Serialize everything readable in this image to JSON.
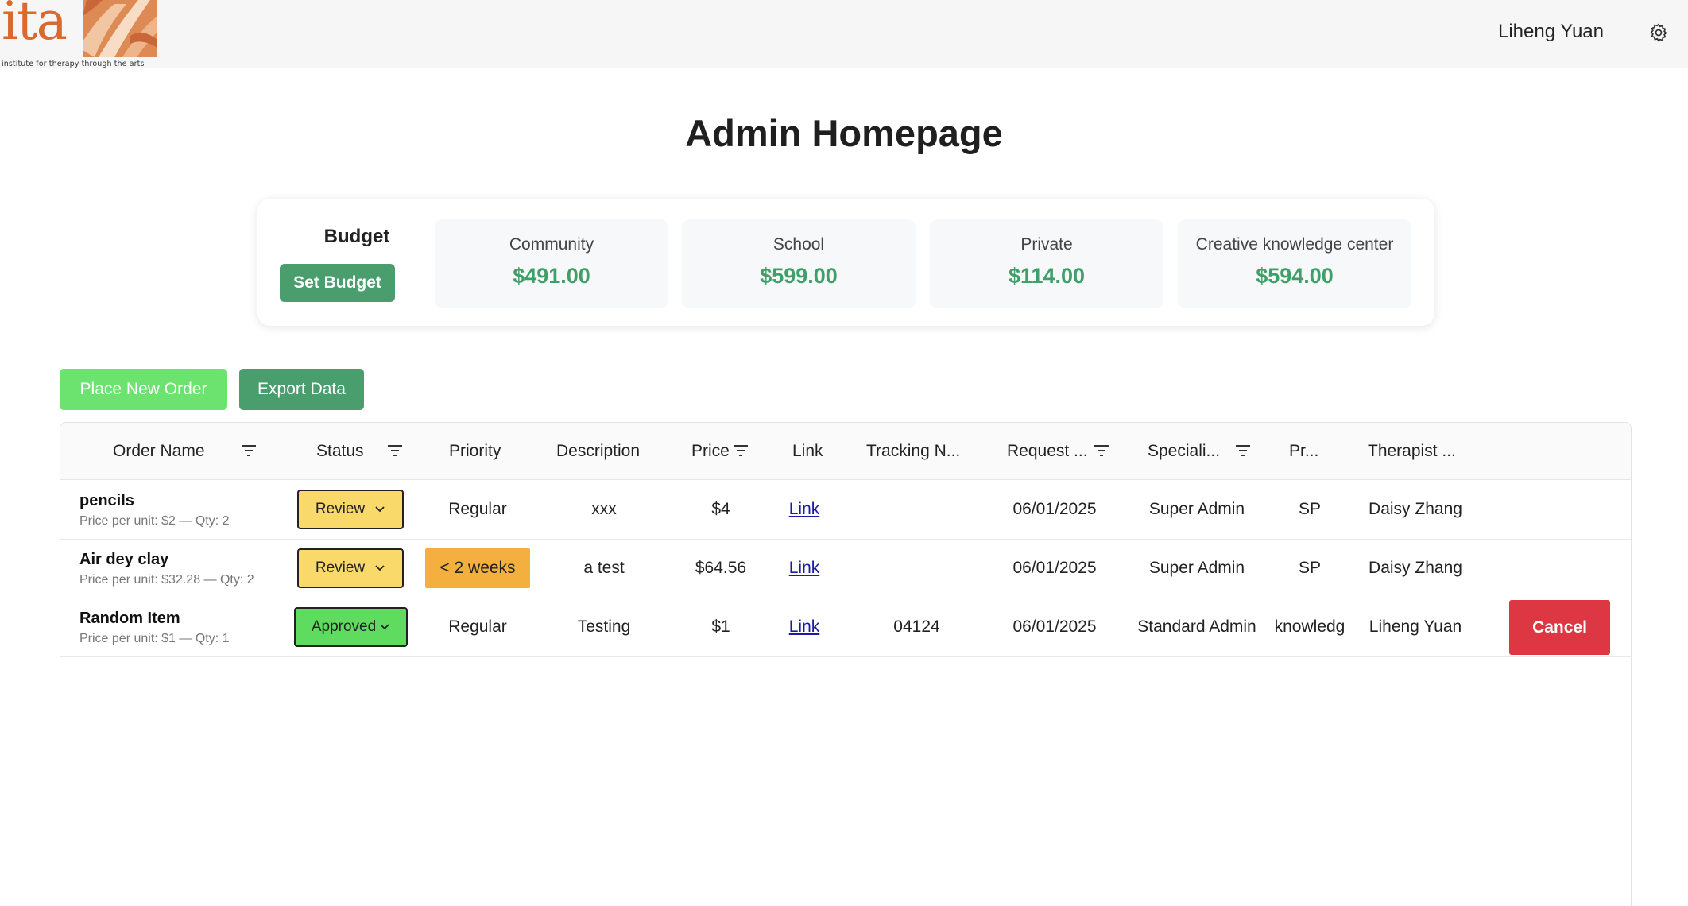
{
  "header": {
    "logo_text": "ita",
    "logo_tagline": "institute for therapy through the arts",
    "user_name": "Liheng Yuan",
    "settings_icon": "gear-icon"
  },
  "page": {
    "title": "Admin Homepage"
  },
  "budget": {
    "label": "Budget",
    "set_budget_label": "Set Budget",
    "tiles": [
      {
        "name": "Community",
        "amount": "$491.00"
      },
      {
        "name": "School",
        "amount": "$599.00"
      },
      {
        "name": "Private",
        "amount": "$114.00"
      },
      {
        "name": "Creative knowledge center",
        "amount": "$594.00"
      }
    ],
    "amount_color": "#3f9f68"
  },
  "actions": {
    "place_order_label": "Place New Order",
    "export_label": "Export Data"
  },
  "table": {
    "columns": [
      "Order Name",
      "Status",
      "Priority",
      "Description",
      "Price",
      "Link",
      "Tracking N...",
      "Request ...",
      "Speciali...",
      "Pr...",
      "Therapist ..."
    ],
    "rows": [
      {
        "name": "pencils",
        "details": "Price per unit: $2 — Qty: 2",
        "status": "Review",
        "priority": "Regular",
        "description": "xxx",
        "price": "$4",
        "link": "Link",
        "tracking": "",
        "request_date": "06/01/2025",
        "specialist": "Super Admin",
        "program": "SP",
        "therapist": "Daisy Zhang"
      },
      {
        "name": "Air dey clay",
        "details": "Price per unit: $32.28 — Qty: 2",
        "status": "Review",
        "priority": "< 2 weeks",
        "description": "a test",
        "price": "$64.56",
        "link": "Link",
        "tracking": "",
        "request_date": "06/01/2025",
        "specialist": "Super Admin",
        "program": "SP",
        "therapist": "Daisy Zhang"
      },
      {
        "name": "Random Item",
        "details": "Price per unit: $1 — Qty: 1",
        "status": "Approved",
        "priority": "Regular",
        "description": "Testing",
        "price": "$1",
        "link": "Link",
        "tracking": "04124",
        "request_date": "06/01/2025",
        "specialist": "Standard Admin",
        "program": "knowledg",
        "therapist": "Liheng Yuan",
        "action": "Cancel"
      }
    ]
  },
  "colors": {
    "primary_green": "#4a9d6c",
    "bright_green": "#6ce36f",
    "review_yellow": "#f8d96a",
    "approved_green": "#5fdc5f",
    "priority_orange": "#f4b03e",
    "cancel_red": "#dd3744"
  }
}
